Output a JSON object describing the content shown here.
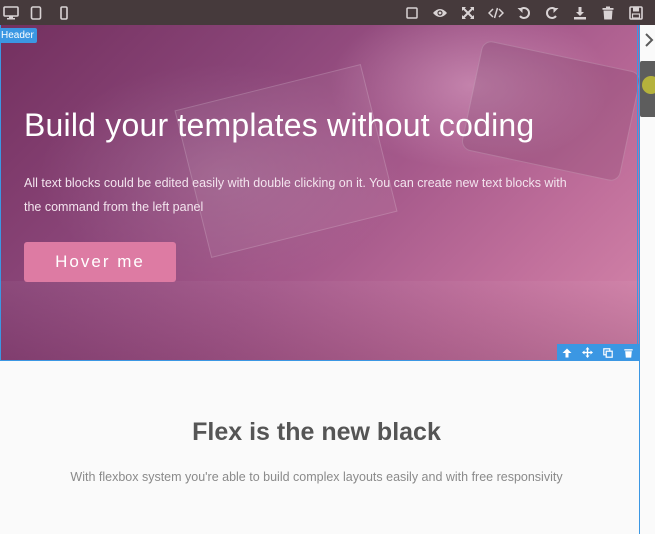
{
  "toolbar": {
    "devices": [
      {
        "name": "desktop-icon",
        "label": "Desktop"
      },
      {
        "name": "tablet-icon",
        "label": "Tablet"
      },
      {
        "name": "mobile-icon",
        "label": "Mobile"
      }
    ],
    "actions": [
      "square-outline-icon",
      "eye-icon",
      "fullscreen-icon",
      "code-icon",
      "undo-icon",
      "redo-icon",
      "download-icon",
      "trash-icon",
      "save-icon"
    ]
  },
  "canvas": {
    "selected_badge": "Header",
    "hero": {
      "title": "Build your templates without coding",
      "text": "All text blocks could be edited easily with double clicking on it. You can create new text blocks with the command from the left panel",
      "button_label": "Hover me"
    },
    "section2": {
      "title": "Flex is the new black",
      "text": "With flexbox system you're able to build complex layouts easily and with free responsivity"
    }
  },
  "colors": {
    "toolbar_bg": "#463a3c",
    "selection": "#3b97e3",
    "button": "#dd7ba3"
  }
}
